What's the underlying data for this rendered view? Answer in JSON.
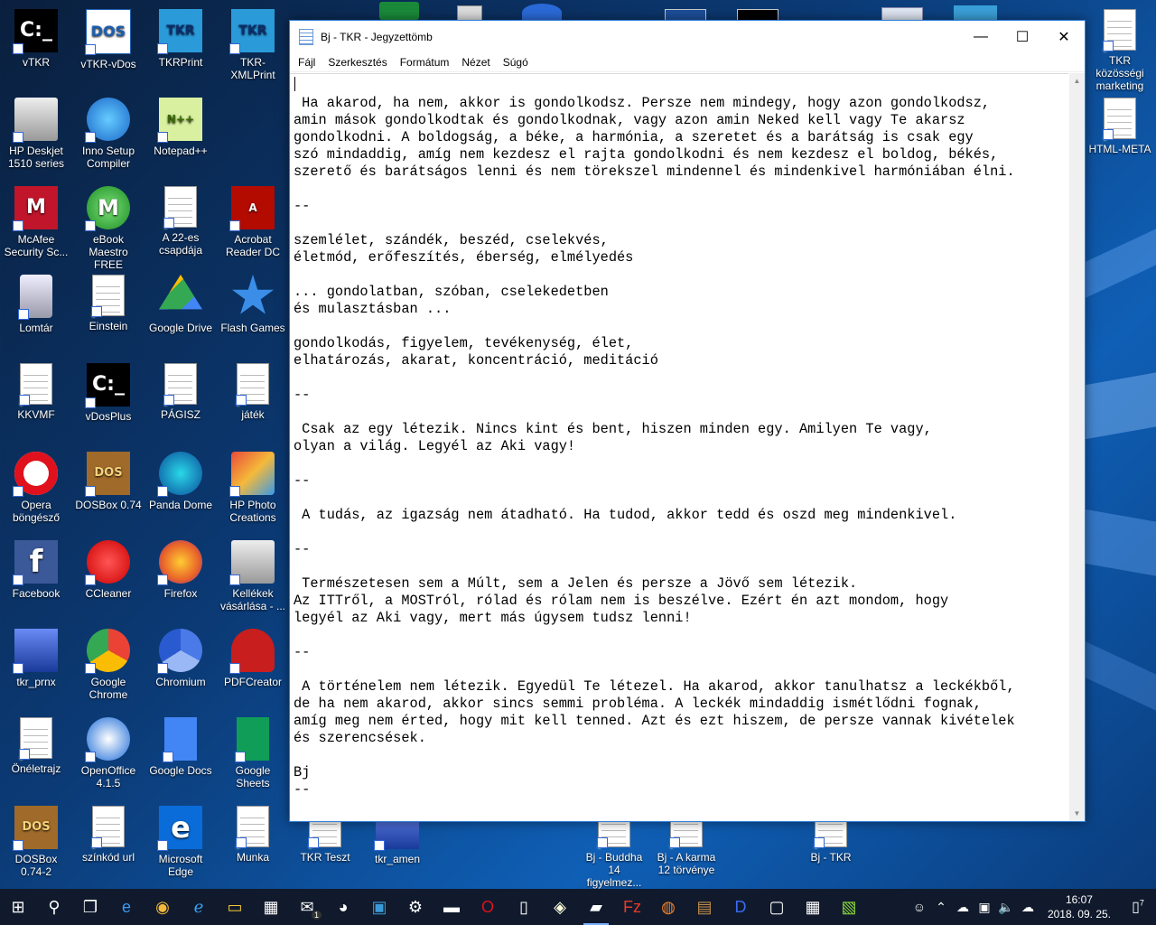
{
  "desktop": {
    "icons": [
      {
        "label": "vTKR",
        "icon": "terminal-icon"
      },
      {
        "label": "vTKR-vDos",
        "icon": "dos-icon"
      },
      {
        "label": "TKRPrint",
        "icon": "tkr-icon"
      },
      {
        "label": "TKR-XMLPrint",
        "icon": "tkr-icon"
      },
      {
        "label": "HP Deskjet 1510 series",
        "icon": "printer-icon"
      },
      {
        "label": "Inno Setup Compiler",
        "icon": "setup-icon"
      },
      {
        "label": "Notepad++",
        "icon": "notepadpp-icon"
      },
      {
        "label": "McAfee Security Sc...",
        "icon": "mcafee-icon"
      },
      {
        "label": "eBook Maestro FREE",
        "icon": "ebook-icon"
      },
      {
        "label": "A 22-es csapdája",
        "icon": "document-icon"
      },
      {
        "label": "Acrobat Reader DC",
        "icon": "acrobat-icon"
      },
      {
        "label": "Lomtár",
        "icon": "recycle-bin-icon"
      },
      {
        "label": "Einstein",
        "icon": "document-icon"
      },
      {
        "label": "Google Drive",
        "icon": "google-drive-icon"
      },
      {
        "label": "Flash Games",
        "icon": "star-icon"
      },
      {
        "label": "KKVMF",
        "icon": "document-icon"
      },
      {
        "label": "vDosPlus",
        "icon": "terminal-icon"
      },
      {
        "label": "PÁGISZ",
        "icon": "document-icon"
      },
      {
        "label": "játék",
        "icon": "document-icon"
      },
      {
        "label": "Opera böngésző",
        "icon": "opera-icon"
      },
      {
        "label": "DOSBox 0.74",
        "icon": "dosbox-icon"
      },
      {
        "label": "Panda Dome",
        "icon": "panda-icon"
      },
      {
        "label": "HP Photo Creations",
        "icon": "photo-icon"
      },
      {
        "label": "Facebook",
        "icon": "facebook-icon"
      },
      {
        "label": "CCleaner",
        "icon": "ccleaner-icon"
      },
      {
        "label": "Firefox",
        "icon": "firefox-icon"
      },
      {
        "label": "Kellékek vásárlása - ...",
        "icon": "printer-icon"
      },
      {
        "label": "tkr_prnx",
        "icon": "building-icon"
      },
      {
        "label": "Google Chrome",
        "icon": "chrome-icon"
      },
      {
        "label": "Chromium",
        "icon": "chromium-icon"
      },
      {
        "label": "PDFCreator",
        "icon": "pdfcreator-icon"
      },
      {
        "label": "Önéletrajz",
        "icon": "document-icon"
      },
      {
        "label": "OpenOffice 4.1.5",
        "icon": "openoffice-icon"
      },
      {
        "label": "Google Docs",
        "icon": "google-docs-icon"
      },
      {
        "label": "Google Sheets",
        "icon": "google-sheets-icon"
      },
      {
        "label": "DOSBox 0.74-2",
        "icon": "dosbox-icon"
      },
      {
        "label": "színkód url",
        "icon": "document-icon"
      },
      {
        "label": "Microsoft Edge",
        "icon": "edge-icon"
      },
      {
        "label": "Munka",
        "icon": "document-icon"
      },
      {
        "label": "TKR Teszt",
        "icon": "document-icon"
      },
      {
        "label": "tkr_amen",
        "icon": "building-icon"
      },
      {
        "label": "Bj - Buddha 14 figyelmez...",
        "icon": "document-icon"
      },
      {
        "label": "Bj - A karma 12 törvénye",
        "icon": "document-icon"
      },
      {
        "label": "Bj - TKR",
        "icon": "document-icon"
      },
      {
        "label": "TKR közösségi marketing",
        "icon": "document-icon"
      },
      {
        "label": "HTML-META",
        "icon": "document-icon"
      }
    ]
  },
  "notepad": {
    "title": "Bj - TKR - Jegyzettömb",
    "menu": [
      "Fájl",
      "Szerkesztés",
      "Formátum",
      "Nézet",
      "Súgó"
    ],
    "text": "\n Ha akarod, ha nem, akkor is gondolkodsz. Persze nem mindegy, hogy azon gondolkodsz,\namin mások gondolkodtak és gondolkodnak, vagy azon amin Neked kell vagy Te akarsz\ngondolkodni. A boldogság, a béke, a harmónia, a szeretet és a barátság is csak egy\nszó mindaddig, amíg nem kezdesz el rajta gondolkodni és nem kezdesz el boldog, békés,\nszerető és barátságos lenni és nem törekszel mindennel és mindenkivel harmóniában élni.\n\n--\n\nszemlélet, szándék, beszéd, cselekvés,\néletmód, erőfeszítés, éberség, elmélyedés\n\n... gondolatban, szóban, cselekedetben\nés mulasztásban ...\n\ngondolkodás, figyelem, tevékenység, élet,\nelhatározás, akarat, koncentráció, meditáció\n\n--\n\n Csak az egy létezik. Nincs kint és bent, hiszen minden egy. Amilyen Te vagy,\nolyan a világ. Legyél az Aki vagy!\n\n--\n\n A tudás, az igazság nem átadható. Ha tudod, akkor tedd és oszd meg mindenkivel.\n\n--\n\n Természetesen sem a Múlt, sem a Jelen és persze a Jövő sem létezik.\nAz ITTről, a MOSTról, rólad és rólam nem is beszélve. Ezért én azt mondom, hogy\nlegyél az Aki vagy, mert más úgysem tudsz lenni!\n\n--\n\n A történelem nem létezik. Egyedül Te létezel. Ha akarod, akkor tanulhatsz a leckékből,\nde ha nem akarod, akkor sincs semmi probléma. A leckék mindaddig ismétlődni fognak,\namíg meg nem érted, hogy mit kell tenned. Azt és ezt hiszem, de persze vannak kivételek\nés szerencsések.\n\nBj\n--"
  },
  "taskbar": {
    "apps": [
      "windows-logo-icon",
      "search-icon",
      "task-view-icon",
      "edge-icon",
      "chrome-icon",
      "ie-icon",
      "file-explorer-icon",
      "store-icon",
      "mail-icon",
      "thunderbird-icon",
      "remote-desktop-icon",
      "settings-icon",
      "terminal-icon",
      "opera-icon",
      "notepad-icon",
      "paint-icon",
      "notepad-active-icon",
      "filezilla-icon",
      "firefox-icon",
      "dosbox-icon",
      "dos-icon",
      "window-icon",
      "calculator-icon",
      "notepadpp-icon"
    ],
    "clock_time": "16:07",
    "clock_date": "2018. 09. 25.",
    "notification_count": "7",
    "mail_badge": "1"
  }
}
